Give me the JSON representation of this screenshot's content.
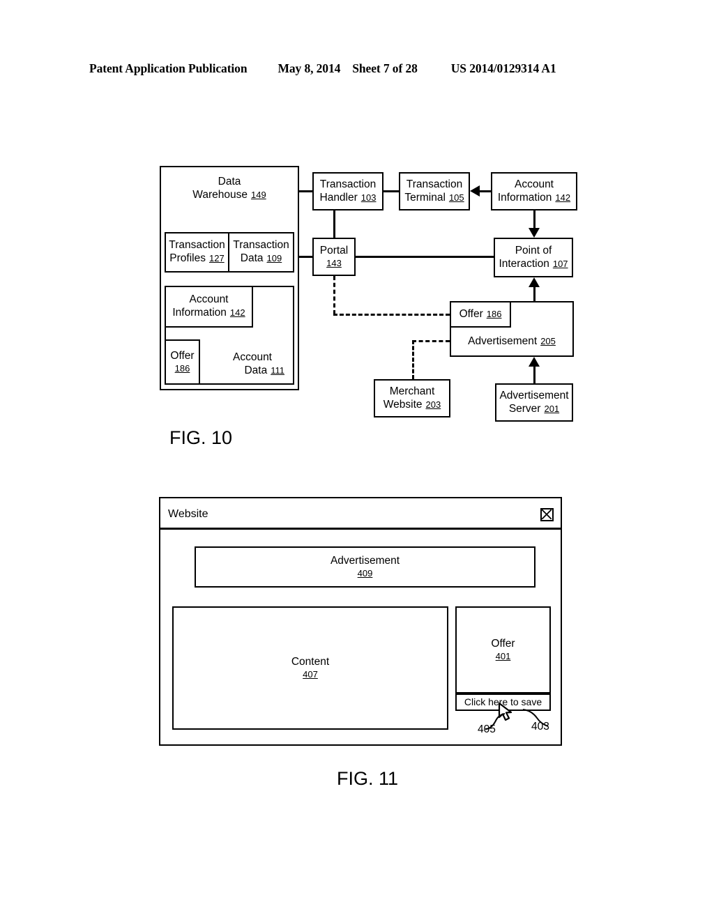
{
  "header": {
    "publication": "Patent Application Publication",
    "date": "May 8, 2014",
    "sheet": "Sheet 7 of 28",
    "patent_number": "US 2014/0129314 A1"
  },
  "fig10": {
    "caption": "FIG. 10",
    "boxes": {
      "data_warehouse": {
        "line1": "Data",
        "line2": "Warehouse",
        "ref": "149"
      },
      "transaction_profiles": {
        "line1": "Transaction",
        "line2": "Profiles",
        "ref": "127"
      },
      "transaction_data": {
        "line1": "Transaction",
        "line2": "Data",
        "ref": "109"
      },
      "account_data": {
        "line1": "Account",
        "line2": "Data",
        "ref": "111"
      },
      "account_information_dw": {
        "line1": "Account",
        "line2": "Information",
        "ref": "142"
      },
      "offer_dw": {
        "line1": "Offer",
        "ref": "186"
      },
      "transaction_handler": {
        "line1": "Transaction",
        "line2": "Handler",
        "ref": "103"
      },
      "transaction_terminal": {
        "line1": "Transaction",
        "line2": "Terminal",
        "ref": "105"
      },
      "account_information": {
        "line1": "Account",
        "line2": "Information",
        "ref": "142"
      },
      "portal": {
        "line1": "Portal",
        "ref": "143"
      },
      "point_of_interaction": {
        "line1": "Point of",
        "line2": "Interaction",
        "ref": "107"
      },
      "offer": {
        "line1": "Offer",
        "ref": "186"
      },
      "advertisement": {
        "line1": "Advertisement",
        "ref": "205"
      },
      "merchant_website": {
        "line1": "Merchant",
        "line2": "Website",
        "ref": "203"
      },
      "advertisement_server": {
        "line1": "Advertisement",
        "line2": "Server",
        "ref": "201"
      }
    }
  },
  "fig11": {
    "caption": "FIG. 11",
    "window_title": "Website",
    "close_icon": "close-x-box-icon",
    "advertisement": {
      "label": "Advertisement",
      "ref": "409"
    },
    "content": {
      "label": "Content",
      "ref": "407"
    },
    "offer": {
      "label": "Offer",
      "ref": "401"
    },
    "save_button": {
      "label": "Click here to save"
    },
    "callouts": {
      "cursor_ref": "405",
      "button_ref": "403"
    },
    "cursor_icon": "mouse-pointer-hand-icon"
  }
}
